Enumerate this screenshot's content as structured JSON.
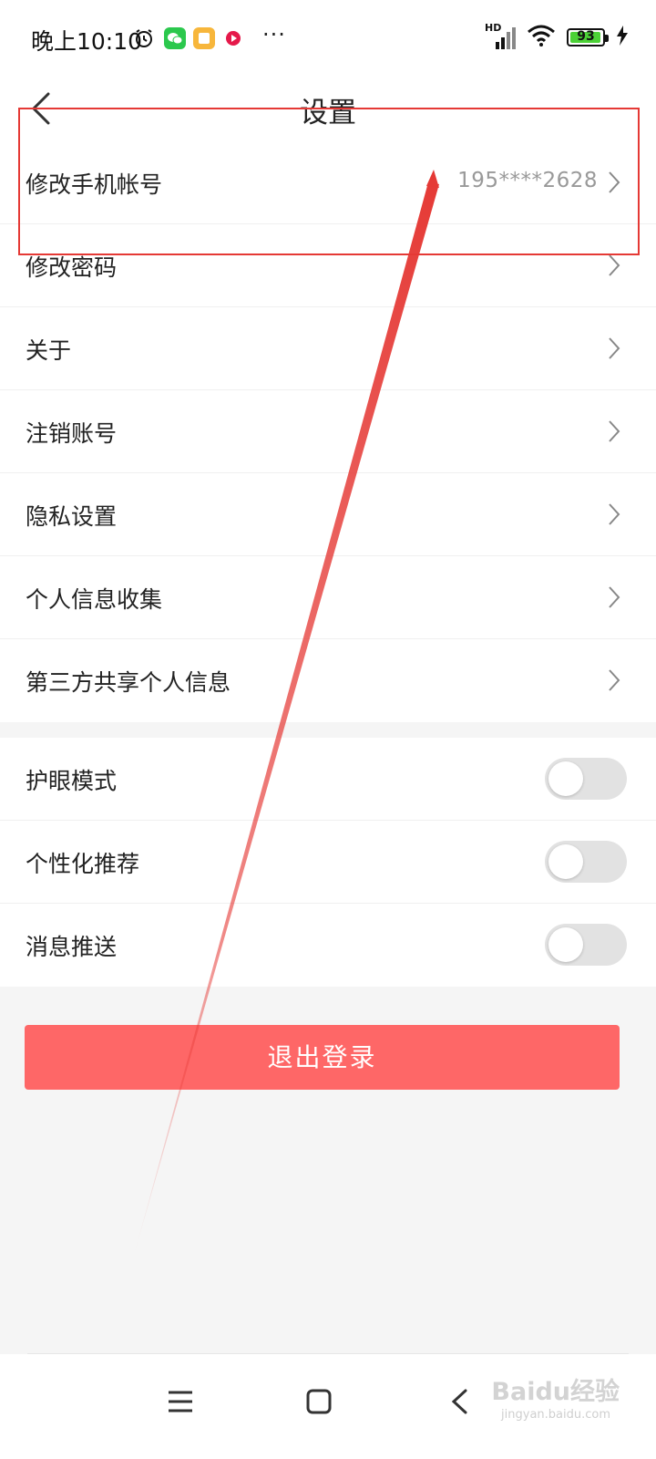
{
  "status_bar": {
    "time": "晚上10:10",
    "dots": "···",
    "network": "HD",
    "battery": "93",
    "app_icons": [
      "alarm-icon",
      "wechat-icon",
      "note-app-icon",
      "video-app-icon"
    ]
  },
  "header": {
    "title": "设置",
    "back_icon": "chevron-left-icon"
  },
  "account_group": [
    {
      "label": "修改手机帐号",
      "value": "195****2628"
    },
    {
      "label": "修改密码",
      "value": ""
    },
    {
      "label": "关于",
      "value": ""
    },
    {
      "label": "注销账号",
      "value": ""
    },
    {
      "label": "隐私设置",
      "value": ""
    },
    {
      "label": "个人信息收集",
      "value": ""
    },
    {
      "label": "第三方共享个人信息",
      "value": ""
    }
  ],
  "toggle_group": [
    {
      "label": "护眼模式",
      "on": false
    },
    {
      "label": "个性化推荐",
      "on": false
    },
    {
      "label": "消息推送",
      "on": false
    }
  ],
  "logout_label": "退出登录",
  "watermark": {
    "brand": "Baidu经验",
    "url": "jingyan.baidu.com"
  },
  "colors": {
    "logout": "#fe6767",
    "annotation": "#e53935",
    "toggle_off": "#e2e2e2",
    "battery": "#4cd137"
  }
}
